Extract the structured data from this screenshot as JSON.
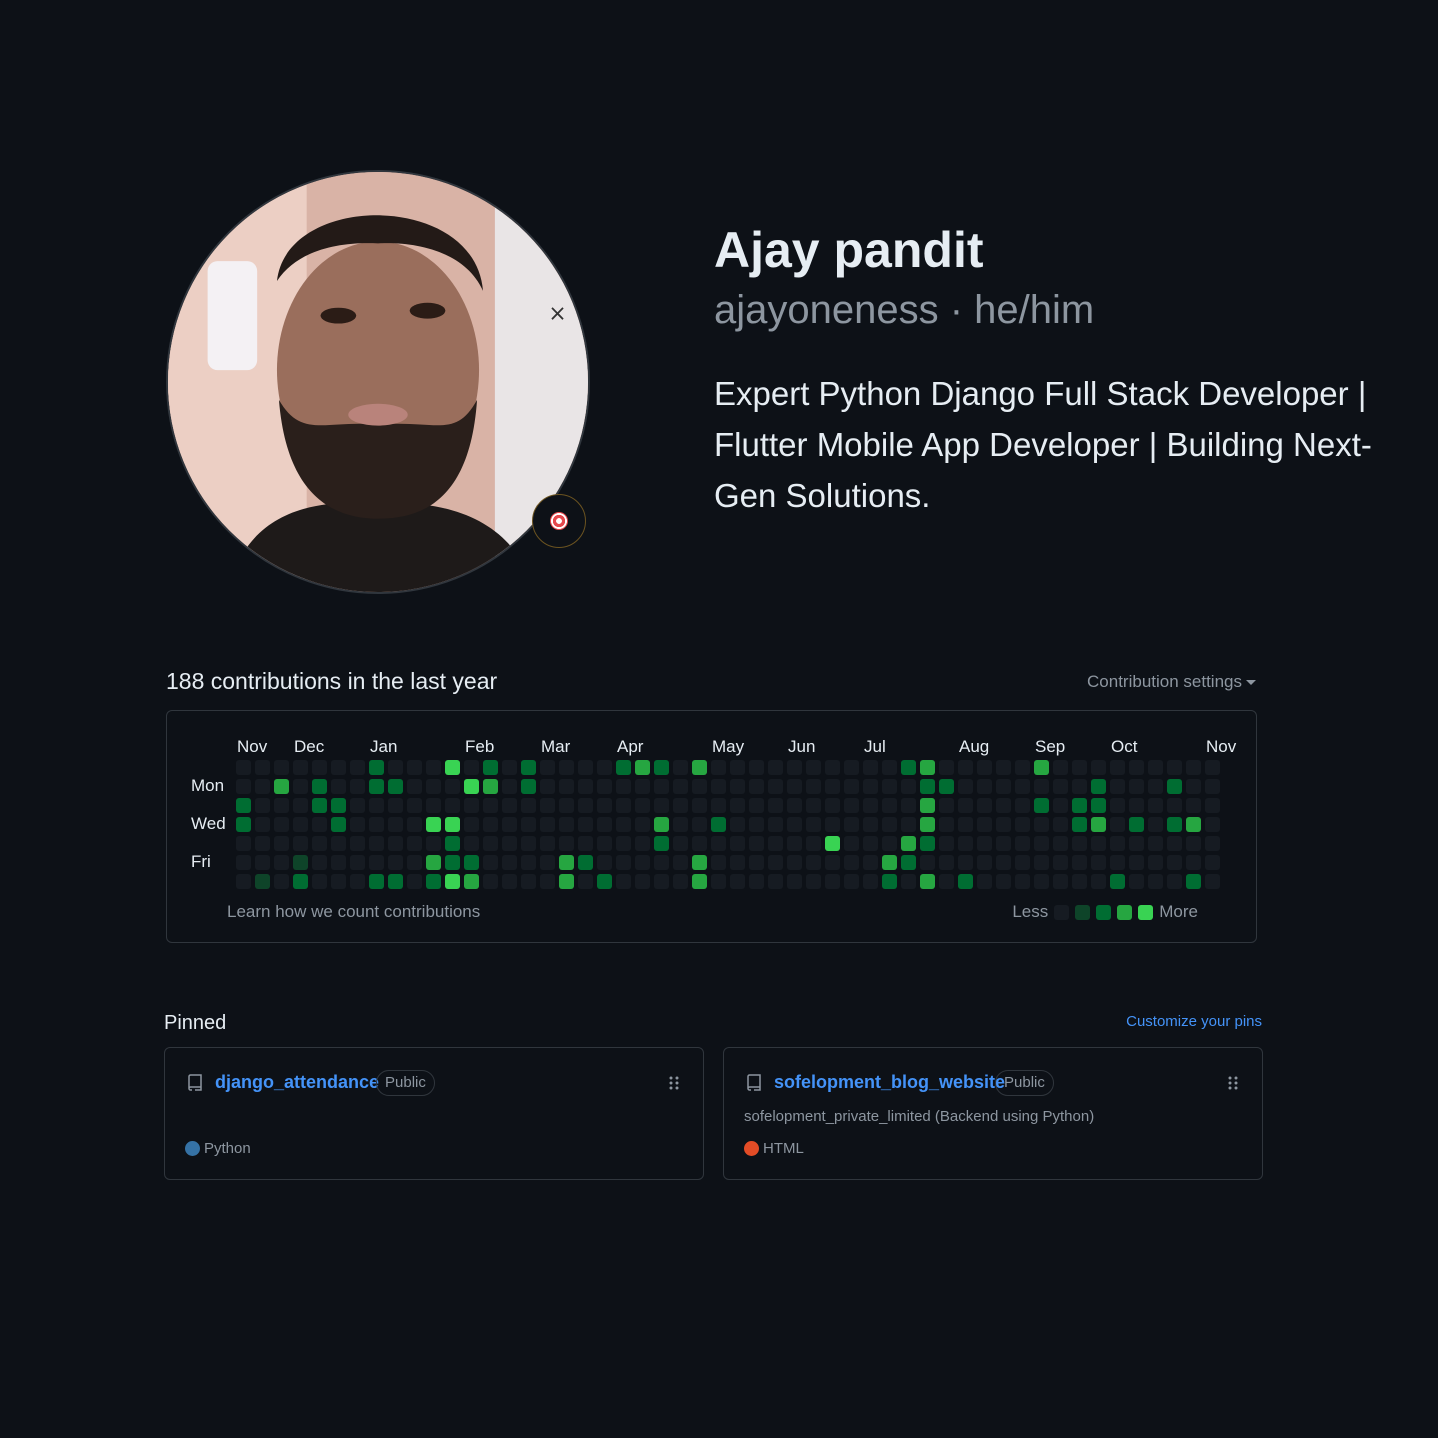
{
  "profile": {
    "full_name": "Ajay pandit",
    "login_line": "ajayoneness · he/him",
    "bio": "Expert Python Django Full Stack Developer | Flutter Mobile App Developer | Building Next-Gen Solutions.",
    "status_icon": "dart-target-icon"
  },
  "contributions": {
    "heading": "188 contributions in the last year",
    "settings_label": "Contribution settings",
    "months": [
      "Nov",
      "Dec",
      "Jan",
      "Feb",
      "Mar",
      "Apr",
      "May",
      "Jun",
      "Jul",
      "Aug",
      "Sep",
      "Oct",
      "Nov"
    ],
    "month_week_index": [
      0,
      3,
      7,
      12,
      16,
      20,
      25,
      29,
      33,
      38,
      42,
      46,
      51
    ],
    "days": [
      "Mon",
      "Wed",
      "Fri"
    ],
    "learn_label": "Learn how we count contributions",
    "legend_less": "Less",
    "legend_more": "More",
    "colors": {
      "level0": "#161b22",
      "level1": "#0e4429",
      "level2": "#006d32",
      "level3": "#26a641",
      "level4": "#39d353"
    },
    "weeks": 52,
    "active_cells": [
      [
        0,
        2,
        2
      ],
      [
        0,
        3,
        2
      ],
      [
        1,
        6,
        1
      ],
      [
        2,
        1,
        3
      ],
      [
        3,
        5,
        1
      ],
      [
        3,
        6,
        2
      ],
      [
        4,
        1,
        2
      ],
      [
        4,
        2,
        2
      ],
      [
        5,
        2,
        2
      ],
      [
        5,
        3,
        2
      ],
      [
        7,
        0,
        2
      ],
      [
        7,
        1,
        2
      ],
      [
        7,
        6,
        2
      ],
      [
        8,
        1,
        2
      ],
      [
        8,
        6,
        2
      ],
      [
        10,
        3,
        4
      ],
      [
        10,
        5,
        3
      ],
      [
        10,
        6,
        2
      ],
      [
        11,
        0,
        4
      ],
      [
        11,
        3,
        4
      ],
      [
        11,
        4,
        2
      ],
      [
        11,
        5,
        2
      ],
      [
        11,
        6,
        4
      ],
      [
        12,
        1,
        4
      ],
      [
        12,
        5,
        2
      ],
      [
        12,
        6,
        3
      ],
      [
        13,
        0,
        2
      ],
      [
        13,
        1,
        3
      ],
      [
        15,
        0,
        2
      ],
      [
        15,
        1,
        2
      ],
      [
        17,
        5,
        3
      ],
      [
        17,
        6,
        3
      ],
      [
        18,
        5,
        2
      ],
      [
        19,
        6,
        2
      ],
      [
        20,
        0,
        2
      ],
      [
        21,
        0,
        3
      ],
      [
        22,
        0,
        2
      ],
      [
        22,
        3,
        3
      ],
      [
        22,
        4,
        2
      ],
      [
        24,
        0,
        3
      ],
      [
        24,
        5,
        3
      ],
      [
        24,
        6,
        3
      ],
      [
        25,
        3,
        2
      ],
      [
        31,
        4,
        4
      ],
      [
        34,
        5,
        3
      ],
      [
        34,
        6,
        2
      ],
      [
        35,
        0,
        2
      ],
      [
        35,
        4,
        3
      ],
      [
        35,
        5,
        2
      ],
      [
        36,
        0,
        3
      ],
      [
        36,
        1,
        2
      ],
      [
        36,
        2,
        3
      ],
      [
        36,
        3,
        3
      ],
      [
        36,
        4,
        2
      ],
      [
        36,
        6,
        3
      ],
      [
        37,
        1,
        2
      ],
      [
        38,
        6,
        2
      ],
      [
        42,
        0,
        3
      ],
      [
        42,
        2,
        2
      ],
      [
        44,
        2,
        2
      ],
      [
        44,
        3,
        2
      ],
      [
        45,
        1,
        2
      ],
      [
        45,
        2,
        2
      ],
      [
        45,
        3,
        3
      ],
      [
        46,
        6,
        2
      ],
      [
        47,
        3,
        2
      ],
      [
        49,
        1,
        2
      ],
      [
        49,
        3,
        2
      ],
      [
        50,
        3,
        3
      ],
      [
        50,
        6,
        2
      ]
    ]
  },
  "pinned": {
    "title": "Pinned",
    "customize_label": "Customize your pins",
    "repos": [
      {
        "name": "django_attendance",
        "visibility": "Public",
        "description": "",
        "language": "Python",
        "language_color": "#3572A5"
      },
      {
        "name": "sofelopment_blog_website",
        "visibility": "Public",
        "description": "sofelopment_private_limited (Backend using Python)",
        "language": "HTML",
        "language_color": "#e34c26"
      }
    ]
  }
}
